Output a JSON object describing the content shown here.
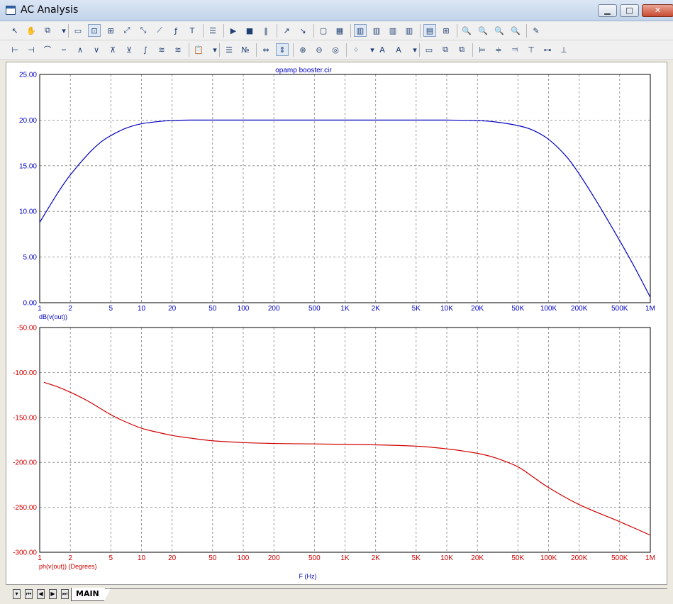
{
  "window": {
    "title": "AC Analysis",
    "minimize_glyph": "▁",
    "maximize_glyph": "□",
    "close_glyph": "✕"
  },
  "toolbar1": [
    {
      "name": "select-arrow-icon",
      "glyph": "↖"
    },
    {
      "name": "pan-hand-icon",
      "glyph": "✋"
    },
    {
      "name": "copy-icon",
      "glyph": "⧉"
    },
    {
      "name": "dropdown-arrow-icon",
      "glyph": "▾"
    },
    {
      "name": "plot-window-icon",
      "glyph": "▭"
    },
    {
      "name": "scale-icon",
      "glyph": "⊡",
      "selected": true
    },
    {
      "name": "zoom-box-icon",
      "glyph": "⊞"
    },
    {
      "name": "cursor-icon",
      "glyph": "⤢"
    },
    {
      "name": "tangent-icon",
      "glyph": "⤡"
    },
    {
      "name": "slope-icon",
      "glyph": "⟋"
    },
    {
      "name": "function-icon",
      "glyph": "ƒ"
    },
    {
      "name": "text-icon",
      "glyph": "T"
    },
    {
      "name": "properties-icon",
      "glyph": "☰"
    },
    {
      "name": "run-icon",
      "glyph": "▶"
    },
    {
      "name": "stop-icon",
      "glyph": "■"
    },
    {
      "name": "pause-icon",
      "glyph": "‖"
    },
    {
      "name": "peak-icon",
      "glyph": "↗"
    },
    {
      "name": "valley-icon",
      "glyph": "↘"
    },
    {
      "name": "frame-icon",
      "glyph": "▢"
    },
    {
      "name": "grid-icon",
      "glyph": "▦"
    },
    {
      "name": "columns-1-icon",
      "glyph": "▥",
      "selected": true
    },
    {
      "name": "columns-2-icon",
      "glyph": "▥"
    },
    {
      "name": "columns-3-icon",
      "glyph": "▥"
    },
    {
      "name": "columns-4-icon",
      "glyph": "▥"
    },
    {
      "name": "rows-icon",
      "glyph": "▤",
      "selected": true
    },
    {
      "name": "tile-icon",
      "glyph": "⊞"
    },
    {
      "name": "zoom-x-icon",
      "glyph": "🔍"
    },
    {
      "name": "zoom-y-icon",
      "glyph": "🔍"
    },
    {
      "name": "zoom-fit-icon",
      "glyph": "🔍"
    },
    {
      "name": "zoom-out-icon",
      "glyph": "🔍"
    },
    {
      "name": "edit-icon",
      "glyph": "✎"
    }
  ],
  "toolbar2": [
    {
      "name": "cursor-left-icon",
      "glyph": "⊢"
    },
    {
      "name": "cursor-right-icon",
      "glyph": "⊣"
    },
    {
      "name": "rise-icon",
      "glyph": "⌒"
    },
    {
      "name": "fall-icon",
      "glyph": "⌣"
    },
    {
      "name": "peak-find-icon",
      "glyph": "∧"
    },
    {
      "name": "valley-find-icon",
      "glyph": "∨"
    },
    {
      "name": "high-icon",
      "glyph": "⊼"
    },
    {
      "name": "low-icon",
      "glyph": "⊻"
    },
    {
      "name": "inflection-icon",
      "glyph": "∫"
    },
    {
      "name": "global-high-icon",
      "glyph": "≋"
    },
    {
      "name": "global-low-icon",
      "glyph": "≋"
    },
    {
      "name": "paste-icon",
      "glyph": "📋"
    },
    {
      "name": "dropdown-arrow-icon",
      "glyph": "▾"
    },
    {
      "name": "list-icon",
      "glyph": "☰"
    },
    {
      "name": "numeric-icon",
      "glyph": "№"
    },
    {
      "name": "fit-x-icon",
      "glyph": "⇔"
    },
    {
      "name": "fit-y-icon",
      "glyph": "⇕",
      "selected": true
    },
    {
      "name": "zoom-in-icon",
      "glyph": "⊕"
    },
    {
      "name": "zoom-out-icon",
      "glyph": "⊖"
    },
    {
      "name": "zoom-100-icon",
      "glyph": "◎"
    },
    {
      "name": "dots-icon",
      "glyph": "⁘"
    },
    {
      "name": "dropdown-arrow-icon",
      "glyph": "▾"
    },
    {
      "name": "font-icon",
      "glyph": "A"
    },
    {
      "name": "font-style-icon",
      "glyph": "A"
    },
    {
      "name": "dropdown-arrow-icon",
      "glyph": "▾"
    },
    {
      "name": "label-icon",
      "glyph": "▭"
    },
    {
      "name": "bring-front-icon",
      "glyph": "⧉"
    },
    {
      "name": "send-back-icon",
      "glyph": "⧉"
    },
    {
      "name": "align-left-icon",
      "glyph": "⊨"
    },
    {
      "name": "align-center-icon",
      "glyph": "≑"
    },
    {
      "name": "align-right-icon",
      "glyph": "⫤"
    },
    {
      "name": "align-top-icon",
      "glyph": "⊤"
    },
    {
      "name": "align-middle-icon",
      "glyph": "⊶"
    },
    {
      "name": "align-bottom-icon",
      "glyph": "⊥"
    }
  ],
  "plot": {
    "circuit_name": "opamp booster.cir",
    "x_axis_label": "F (Hz)",
    "grid_color": "#808080",
    "axis_color": "#000000"
  },
  "chart_data": [
    {
      "type": "line",
      "title": "opamp booster.cir",
      "xlabel": "F (Hz)",
      "ylabel": "dB(v(out))",
      "xscale": "log",
      "xlim": [
        1,
        1000000
      ],
      "ylim": [
        0,
        25
      ],
      "grid": true,
      "x_tick_values": [
        1,
        2,
        5,
        10,
        20,
        50,
        100,
        200,
        500,
        1000,
        2000,
        5000,
        10000,
        20000,
        50000,
        100000,
        200000,
        500000,
        1000000
      ],
      "x_tick_labels": [
        "1",
        "2",
        "5",
        "10",
        "20",
        "50",
        "100",
        "200",
        "500",
        "1K",
        "2K",
        "5K",
        "10K",
        "20K",
        "50K",
        "100K",
        "200K",
        "500K",
        "1M"
      ],
      "y_tick_values": [
        0,
        5,
        10,
        15,
        20,
        25
      ],
      "y_tick_labels": [
        "0.00",
        "5.00",
        "10.00",
        "15.00",
        "20.00",
        "25.00"
      ],
      "color": "#0000c0",
      "series": [
        {
          "name": "dB(v(out))",
          "x": [
            1,
            1.5,
            2,
            3,
            4,
            5,
            7,
            10,
            15,
            20,
            30,
            50,
            100,
            1000,
            10000,
            20000,
            30000,
            50000,
            70000,
            100000,
            150000,
            200000,
            300000,
            500000,
            700000,
            1000000
          ],
          "y": [
            8.8,
            12.0,
            14.0,
            16.3,
            17.6,
            18.3,
            19.1,
            19.6,
            19.85,
            19.95,
            20.0,
            20.0,
            20.0,
            20.0,
            20.0,
            19.95,
            19.8,
            19.4,
            18.9,
            17.9,
            16.0,
            14.1,
            11.0,
            6.8,
            3.9,
            0.6
          ]
        }
      ]
    },
    {
      "type": "line",
      "xlabel": "F (Hz)",
      "ylabel": "ph(v(out)) (Degrees)",
      "xscale": "log",
      "xlim": [
        1,
        1000000
      ],
      "ylim": [
        -300,
        -50
      ],
      "grid": true,
      "x_tick_values": [
        1,
        2,
        5,
        10,
        20,
        50,
        100,
        200,
        500,
        1000,
        2000,
        5000,
        10000,
        20000,
        50000,
        100000,
        200000,
        500000,
        1000000
      ],
      "x_tick_labels": [
        "1",
        "2",
        "5",
        "10",
        "20",
        "50",
        "100",
        "200",
        "500",
        "1K",
        "2K",
        "5K",
        "10K",
        "20K",
        "50K",
        "100K",
        "200K",
        "500K",
        "1M"
      ],
      "y_tick_values": [
        -300,
        -250,
        -200,
        -150,
        -100,
        -50
      ],
      "y_tick_labels": [
        "-300.00",
        "-250.00",
        "-200.00",
        "-150.00",
        "-100.00",
        "-50.00"
      ],
      "color": "#d00000",
      "series": [
        {
          "name": "ph(v(out)) (Degrees)",
          "x": [
            1.1,
            1.5,
            2,
            3,
            5,
            7,
            10,
            15,
            20,
            30,
            50,
            100,
            200,
            500,
            1000,
            2000,
            5000,
            10000,
            20000,
            30000,
            50000,
            70000,
            100000,
            200000,
            500000,
            1000000
          ],
          "y": [
            -111,
            -116,
            -122,
            -132,
            -147,
            -155,
            -162,
            -167,
            -170,
            -173,
            -176,
            -178,
            -179,
            -179.5,
            -180,
            -180.5,
            -182,
            -185,
            -190,
            -195,
            -205,
            -216,
            -228,
            -247,
            -266,
            -281
          ]
        }
      ]
    }
  ],
  "status_bar": {
    "nav_buttons": [
      "▾",
      "⏮",
      "◀",
      "▶",
      "⏭"
    ],
    "active_tab": "MAIN"
  }
}
